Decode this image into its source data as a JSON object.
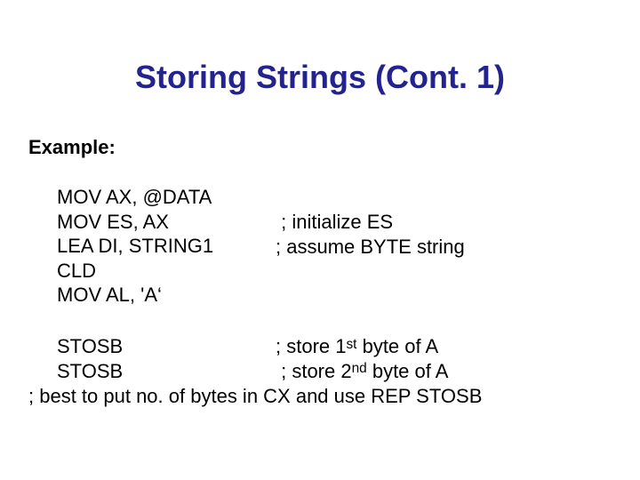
{
  "title": "Storing Strings (Cont. 1)",
  "subheading": "Example:",
  "block1": {
    "l1": "MOV AX, @DATA",
    "l2": "MOV ES, AX",
    "l3": "LEA DI, STRING1",
    "l4": "CLD",
    "l5": "MOV AL, 'A‘"
  },
  "comments1": {
    "c1": " ; initialize ES",
    "c2": "; assume BYTE string"
  },
  "block2": {
    "l1": "STOSB",
    "l2": "STOSB"
  },
  "comments2": {
    "c1_pre": "; store 1",
    "c1_ord": "st",
    "c1_post": " byte of A",
    "c2_pre": " ; store 2",
    "c2_ord": "nd",
    "c2_post": " byte of A"
  },
  "lastline": "; best to put no. of bytes in CX and use REP STOSB"
}
